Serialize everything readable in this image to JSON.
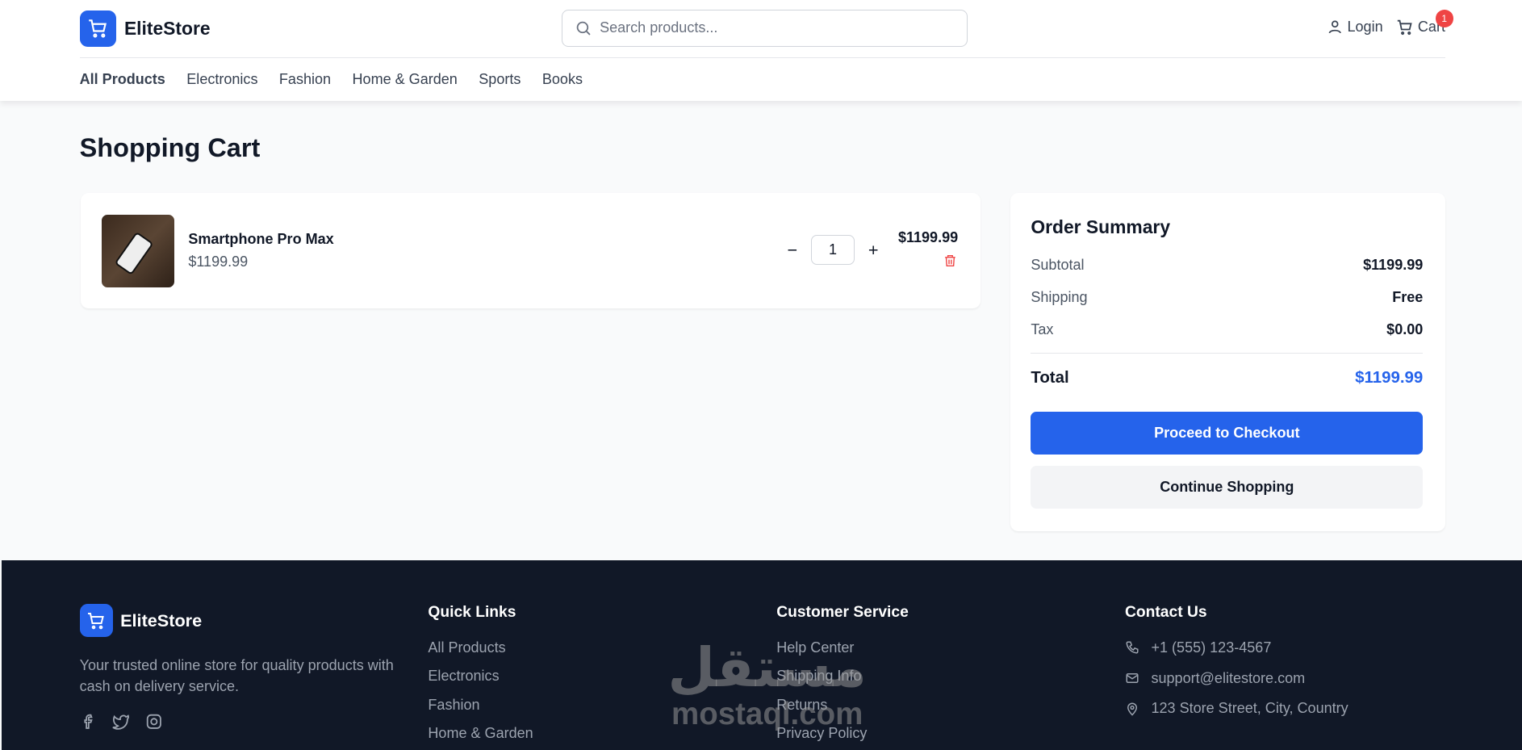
{
  "header": {
    "logo": "EliteStore",
    "search_placeholder": "Search products...",
    "login": "Login",
    "cart": "Cart",
    "cart_count": "1"
  },
  "nav": [
    "All Products",
    "Electronics",
    "Fashion",
    "Home & Garden",
    "Sports",
    "Books"
  ],
  "page_title": "Shopping Cart",
  "cart_items": [
    {
      "name": "Smartphone Pro Max",
      "price": "$1199.99",
      "quantity": "1",
      "total": "$1199.99"
    }
  ],
  "summary": {
    "title": "Order Summary",
    "subtotal_label": "Subtotal",
    "subtotal": "$1199.99",
    "shipping_label": "Shipping",
    "shipping": "Free",
    "tax_label": "Tax",
    "tax": "$0.00",
    "total_label": "Total",
    "total": "$1199.99",
    "checkout": "Proceed to Checkout",
    "continue": "Continue Shopping",
    "accent": "#2563eb"
  },
  "footer": {
    "logo": "EliteStore",
    "tagline": "Your trusted online store for quality products with cash on delivery service.",
    "quick_links_title": "Quick Links",
    "quick_links": [
      "All Products",
      "Electronics",
      "Fashion",
      "Home & Garden"
    ],
    "service_title": "Customer Service",
    "service_links": [
      "Help Center",
      "Shipping Info",
      "Returns",
      "Privacy Policy"
    ],
    "contact_title": "Contact Us",
    "phone": "+1 (555) 123-4567",
    "email": "support@elitestore.com",
    "address": "123 Store Street, City, Country"
  },
  "watermark": {
    "arabic": "مستقل",
    "latin": "mostaql.com"
  }
}
